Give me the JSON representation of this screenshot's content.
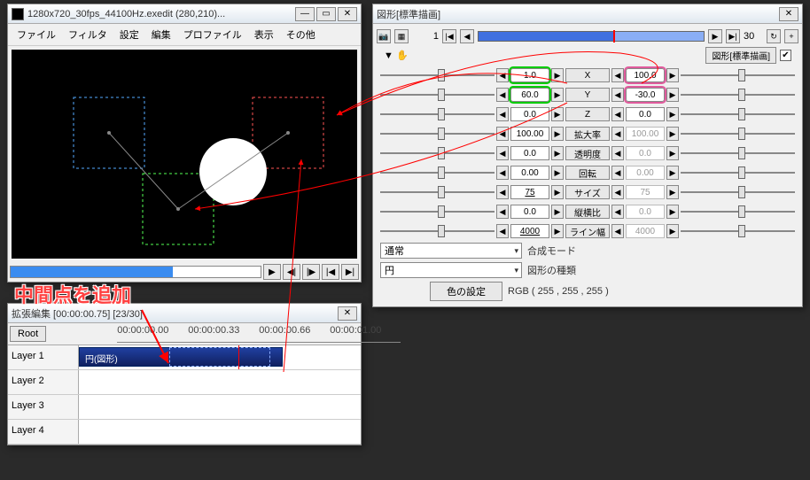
{
  "preview_window": {
    "title": "1280x720_30fps_44100Hz.exedit (280,210)...",
    "menus": [
      "ファイル",
      "フィルタ",
      "設定",
      "編集",
      "プロファイル",
      "表示",
      "その他"
    ]
  },
  "timeline_window": {
    "title": "拡張編集 [00:00:00.75] [23/30]",
    "root": "Root",
    "times": [
      "00:00:00.00",
      "00:00:00.33",
      "00:00:00.66",
      "00:00:01.00"
    ],
    "layers": [
      "Layer 1",
      "Layer 2",
      "Layer 3",
      "Layer 4"
    ],
    "clip_label": "円(図形)"
  },
  "props_window": {
    "title": "図形[標準描画]",
    "frame_start": "1",
    "frame_end": "30",
    "type_label": "図形[標準描画]",
    "params": [
      {
        "name": "X",
        "left": "1.0",
        "right": "100.0",
        "left_hl": "green",
        "right_hl": "pink"
      },
      {
        "name": "Y",
        "left": "60.0",
        "right": "-30.0",
        "left_hl": "green",
        "right_hl": "pink"
      },
      {
        "name": "Z",
        "left": "0.0",
        "right": "0.0"
      },
      {
        "name": "拡大率",
        "left": "100.00",
        "right": "100.00",
        "right_dim": true
      },
      {
        "name": "透明度",
        "left": "0.0",
        "right": "0.0",
        "right_dim": true
      },
      {
        "name": "回転",
        "left": "0.00",
        "right": "0.00",
        "right_dim": true
      },
      {
        "name": "サイズ",
        "left": "75",
        "right": "75",
        "right_dim": true,
        "left_u": true
      },
      {
        "name": "縦横比",
        "left": "0.0",
        "right": "0.0",
        "right_dim": true
      },
      {
        "name": "ライン幅",
        "left": "4000",
        "right": "4000",
        "right_dim": true,
        "left_u": true
      }
    ],
    "blend_label": "合成モード",
    "blend_value": "通常",
    "shape_label": "図形の種類",
    "shape_value": "円",
    "color_btn": "色の設定",
    "color_value": "RGB ( 255 , 255 , 255 )"
  },
  "annotation": "中間点を追加"
}
